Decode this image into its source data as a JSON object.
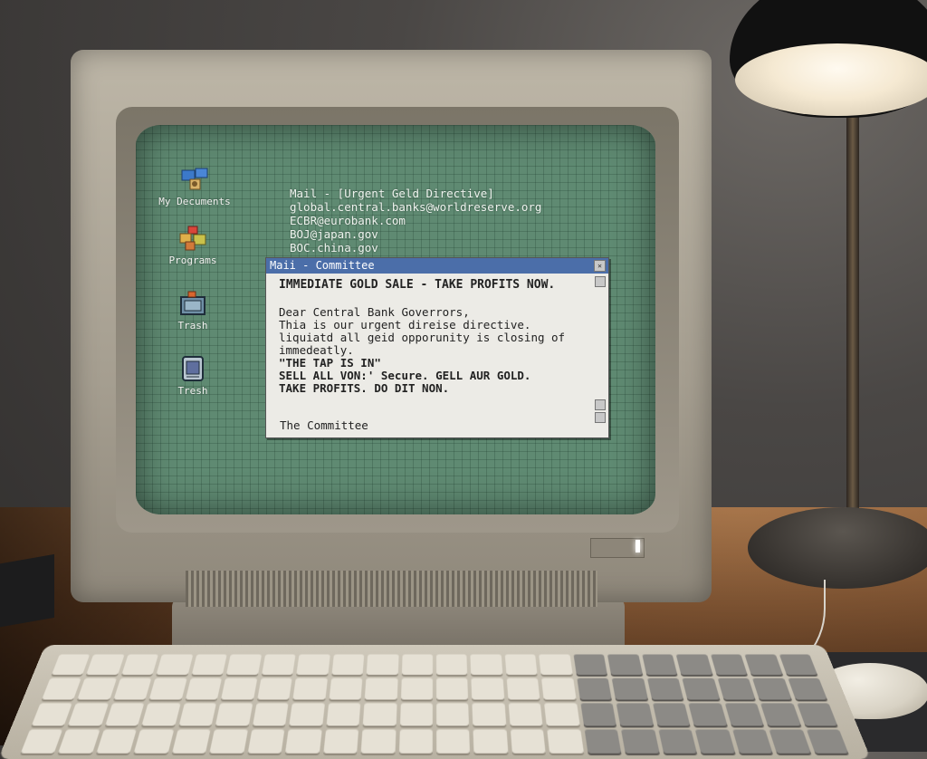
{
  "desktop": {
    "icons": [
      {
        "label": "My Decuments",
        "icon": "documents-icon"
      },
      {
        "label": "Programs",
        "icon": "programs-icon"
      },
      {
        "label": "Trash",
        "icon": "trash-icon"
      },
      {
        "label": "Tresh",
        "icon": "trash-icon"
      }
    ]
  },
  "mail_header": {
    "title": "Mail - [Urgent Geld Directive]",
    "recipients": [
      "global.central.banks@worldreserve.org",
      "ECBR@eurobank.com",
      "BOJ@japan.gov",
      "BOC.china.gov"
    ]
  },
  "window": {
    "title": "Maii - Committee",
    "subject": "IMMEDIATE GOLD SALE - TAKE PROFITS NOW.",
    "lines": [
      "Dear Central Bank Goverrors,",
      "Thia is our urgent direise directive.",
      "liquiatd all geid opporunity is closing of",
      "immedeatly."
    ],
    "bold_lines": [
      "\"THE TAP IS IN\"",
      "SELL ALL VON:' Secure. GELL AUR GOLD.",
      "TAKE PROFITS. DO DIT NON."
    ],
    "signature": "The Committee"
  },
  "colors": {
    "screen": "#5f8a72",
    "titlebar": "#4b6ea9",
    "window_bg": "#ecebe6"
  }
}
